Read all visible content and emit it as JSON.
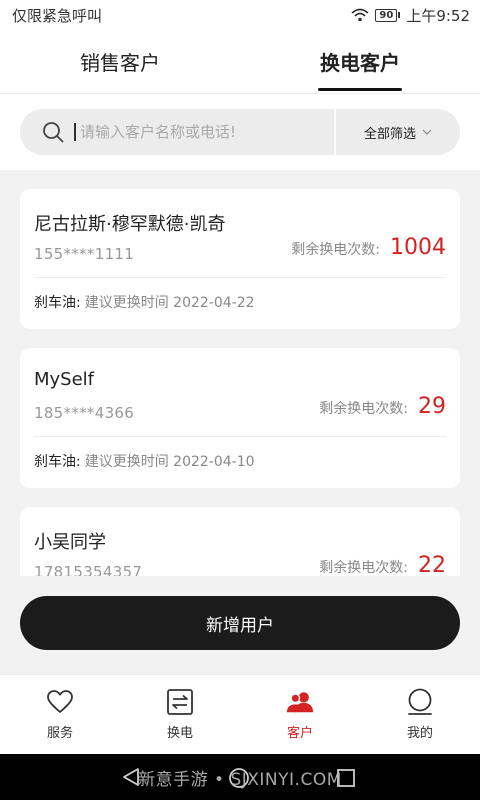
{
  "status_bar": {
    "left_text": "仅限紧急呼叫",
    "battery": "90",
    "time": "上午9:52"
  },
  "tabs": [
    {
      "label": "销售客户",
      "active": false
    },
    {
      "label": "换电客户",
      "active": true
    }
  ],
  "search": {
    "placeholder": "请输入客户名称或电话!",
    "filter_label": "全部筛选"
  },
  "customers": [
    {
      "name": "尼古拉斯·穆罕默德·凯奇",
      "phone": "155****1111",
      "count_label": "剩余换电次数:",
      "count": "1004",
      "item_name": "刹车油:",
      "item_desc": "建议更换时间 2022-04-22"
    },
    {
      "name": "MySelf",
      "phone": "185****4366",
      "count_label": "剩余换电次数:",
      "count": "29",
      "item_name": "刹车油:",
      "item_desc": "建议更换时间 2022-04-10"
    },
    {
      "name": "小吴同学",
      "phone": "17815354357",
      "count_label": "剩余换电次数:",
      "count": "22"
    }
  ],
  "add_button": "新增用户",
  "bottom_nav": [
    {
      "label": "服务",
      "icon": "heart-icon",
      "active": false
    },
    {
      "label": "换电",
      "icon": "swap-icon",
      "active": false
    },
    {
      "label": "客户",
      "icon": "users-icon",
      "active": true
    },
    {
      "label": "我的",
      "icon": "user-icon",
      "active": false
    }
  ],
  "watermark": "新意手游 • SJXINYI.COM",
  "colors": {
    "accent": "#d42222",
    "button": "#1b1b1b"
  }
}
